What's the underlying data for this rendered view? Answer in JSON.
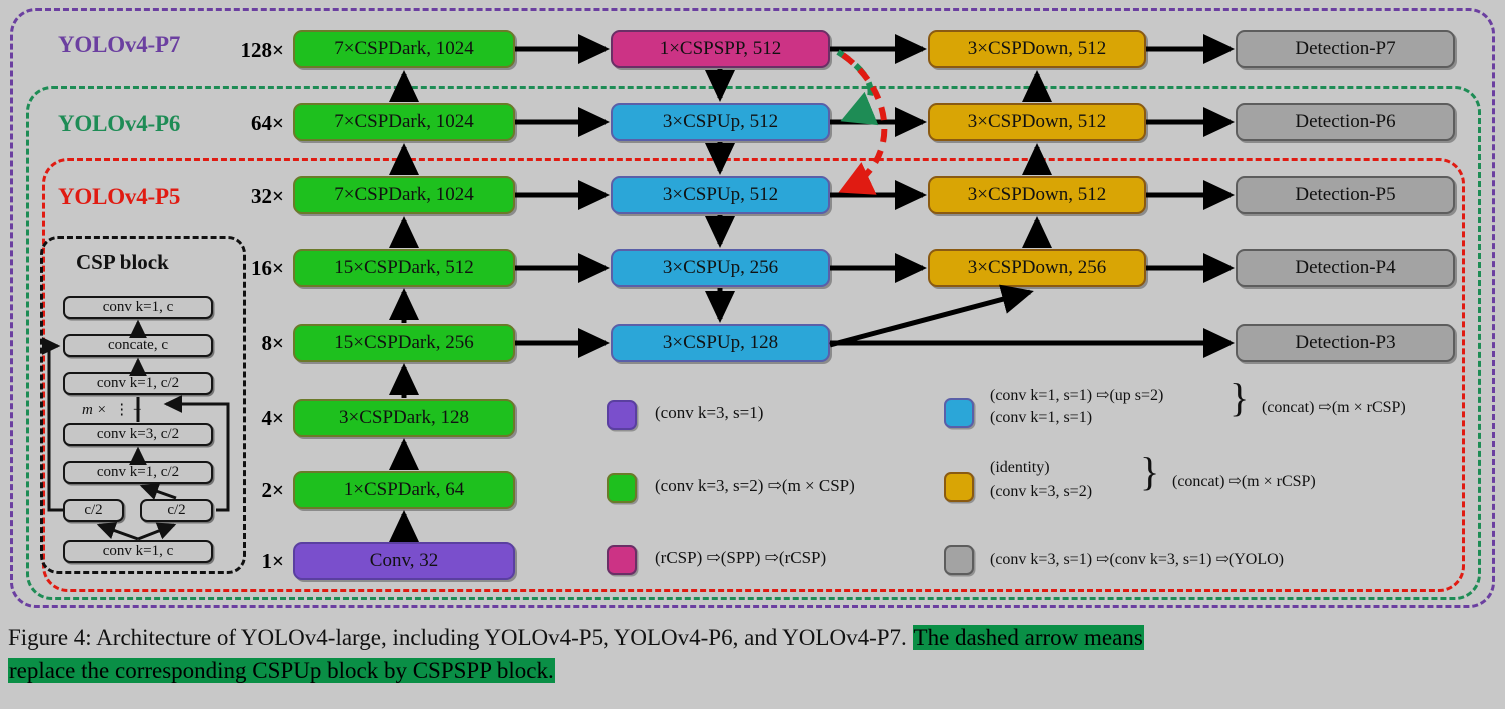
{
  "figure": {
    "colors": {
      "green": "#1ec01e",
      "blue": "#2ba6d8",
      "gold": "#d9a505",
      "magenta": "#cc3385",
      "purple": "#7a4fcc",
      "grey": "#a3a3a3",
      "scope_p7": "#6b3fa0",
      "scope_p6": "#1e8c55",
      "scope_p5": "#e01b12",
      "highlight": "#0a8f46",
      "background": "#c8c8c8"
    }
  },
  "scopes": [
    {
      "id": "p7",
      "label": "YOLOv4-P7",
      "color": "#6b3fa0"
    },
    {
      "id": "p6",
      "label": "YOLOv4-P6",
      "color": "#1e8c55"
    },
    {
      "id": "p5",
      "label": "YOLOv4-P5",
      "color": "#e01b12"
    }
  ],
  "scales": [
    "128×",
    "64×",
    "32×",
    "16×",
    "8×",
    "4×",
    "2×",
    "1×"
  ],
  "backbone": [
    {
      "label": "7×CSPDark, 1024",
      "color": "green"
    },
    {
      "label": "7×CSPDark, 1024",
      "color": "green"
    },
    {
      "label": "7×CSPDark, 1024",
      "color": "green"
    },
    {
      "label": "15×CSPDark, 512",
      "color": "green"
    },
    {
      "label": "15×CSPDark, 256",
      "color": "green"
    },
    {
      "label": "3×CSPDark, 128",
      "color": "green"
    },
    {
      "label": "1×CSPDark, 64",
      "color": "green"
    },
    {
      "label": "Conv, 32",
      "color": "purple"
    }
  ],
  "neck_up": [
    {
      "label": "1×CSPSPP, 512",
      "color": "magenta"
    },
    {
      "label": "3×CSPUp, 512",
      "color": "blue"
    },
    {
      "label": "3×CSPUp, 512",
      "color": "blue"
    },
    {
      "label": "3×CSPUp, 256",
      "color": "blue"
    },
    {
      "label": "3×CSPUp, 128",
      "color": "blue"
    }
  ],
  "neck_down": [
    {
      "label": "3×CSPDown, 512",
      "color": "gold"
    },
    {
      "label": "3×CSPDown, 512",
      "color": "gold"
    },
    {
      "label": "3×CSPDown, 512",
      "color": "gold"
    },
    {
      "label": "3×CSPDown, 256",
      "color": "gold"
    }
  ],
  "heads": [
    {
      "label": "Detection-P7",
      "color": "grey"
    },
    {
      "label": "Detection-P6",
      "color": "grey"
    },
    {
      "label": "Detection-P5",
      "color": "grey"
    },
    {
      "label": "Detection-P4",
      "color": "grey"
    },
    {
      "label": "Detection-P3",
      "color": "grey"
    }
  ],
  "csp_block": {
    "title": "CSP block",
    "rows": [
      "conv k=1, c",
      "concate, c",
      "conv k=1, c/2",
      "conv k=3, c/2",
      "conv k=1, c/2",
      "c/2",
      "c/2",
      "conv k=1, c"
    ],
    "repeat_marker": "m ×"
  },
  "legend": {
    "left": [
      {
        "color": "purple",
        "text": "(conv k=3, s=1)"
      },
      {
        "color": "green",
        "text": "(conv k=3, s=2) ⇨(m × CSP)"
      },
      {
        "color": "magenta",
        "text": "(rCSP) ⇨(SPP) ⇨(rCSP)"
      }
    ],
    "right": [
      {
        "color": "blue",
        "line1": "(conv k=1, s=1) ⇨(up s=2)",
        "line2": "(conv k=1, s=1)",
        "tail": "(concat) ⇨(m × rCSP)"
      },
      {
        "color": "gold",
        "line1": "(identity)",
        "line2": "(conv k=3, s=2)",
        "tail": "(concat) ⇨(m × rCSP)"
      },
      {
        "color": "grey",
        "line1": "(conv k=3, s=1) ⇨(conv k=3, s=1) ⇨(YOLO)",
        "line2": "",
        "tail": ""
      }
    ]
  },
  "caption": {
    "plain_1": "Figure 4: Architecture of YOLOv4-large, including YOLOv4-P5, YOLOv4-P6, and YOLOv4-P7. ",
    "highlight_1": "The dashed arrow means",
    "highlight_2": "replace the corresponding CSPUp block by CSPSPP block."
  }
}
